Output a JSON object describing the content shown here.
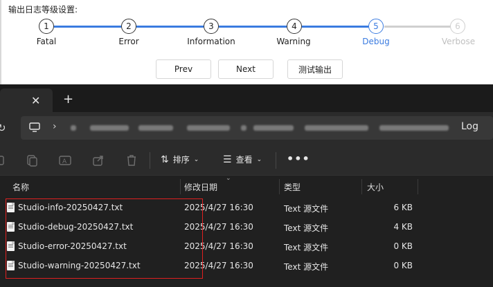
{
  "settings": {
    "label": "输出日志等级设置:",
    "steps": [
      {
        "num": "1",
        "label": "Fatal",
        "state": "done"
      },
      {
        "num": "2",
        "label": "Error",
        "state": "done"
      },
      {
        "num": "3",
        "label": "Information",
        "state": "done"
      },
      {
        "num": "4",
        "label": "Warning",
        "state": "done"
      },
      {
        "num": "5",
        "label": "Debug",
        "state": "active"
      },
      {
        "num": "6",
        "label": "Verbose",
        "state": "pending"
      }
    ],
    "buttons": {
      "prev": "Prev",
      "next": "Next",
      "test": "测试输出"
    },
    "colors": {
      "active": "#3a7be0",
      "pending": "#cfcfcf",
      "done": "#333333"
    }
  },
  "explorer": {
    "tab": {
      "close_icon": "close-icon",
      "add_icon": "plus-icon"
    },
    "address": {
      "last_segment": "Log"
    },
    "toolbar": {
      "sort_label": "排序",
      "view_label": "查看",
      "more_label": "•••"
    },
    "columns": {
      "name": "名称",
      "modified": "修改日期",
      "type": "类型",
      "size": "大小"
    },
    "files": [
      {
        "name": "Studio-info-20250427.txt",
        "modified": "2025/4/27 16:30",
        "type": "Text 源文件",
        "size": "6 KB"
      },
      {
        "name": "Studio-debug-20250427.txt",
        "modified": "2025/4/27 16:30",
        "type": "Text 源文件",
        "size": "4 KB"
      },
      {
        "name": "Studio-error-20250427.txt",
        "modified": "2025/4/27 16:30",
        "type": "Text 源文件",
        "size": "0 KB"
      },
      {
        "name": "Studio-warning-20250427.txt",
        "modified": "2025/4/27 16:30",
        "type": "Text 源文件",
        "size": "0 KB"
      }
    ],
    "highlight_color": "#e02020"
  }
}
